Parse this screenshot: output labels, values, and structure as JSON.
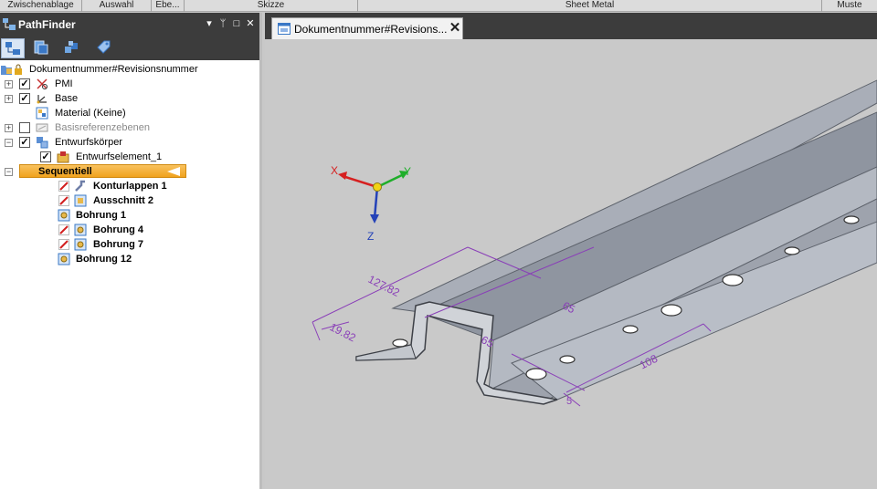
{
  "ribbon_groups": [
    "Zwischenablage",
    "Auswahl",
    "Ebe...",
    "Skizze",
    "Sheet Metal",
    "Muste"
  ],
  "panel": {
    "title": "PathFinder",
    "controls": [
      "▾",
      "ᛘ",
      "□",
      "✕"
    ],
    "tree": {
      "root": "Dokumentnummer#Revisionsnummer",
      "pmi": "PMI",
      "base": "Base",
      "material": "Material (Keine)",
      "basisref": "Basisreferenzebenen",
      "entwurfskoerper": "Entwurfskörper",
      "entwurfselement": "Entwurfselement_1",
      "sequentiell": "Sequentiell",
      "konturlappen": "Konturlappen 1",
      "ausschnitt": "Ausschnitt 2",
      "bohrung1": "Bohrung 1",
      "bohrung4": "Bohrung 4",
      "bohrung7": "Bohrung 7",
      "bohrung12": "Bohrung 12"
    }
  },
  "document_tab": {
    "label": "Dokumentnummer#Revisions...",
    "close": "✕"
  },
  "triad": {
    "x": "X",
    "y": "Y",
    "z": "Z"
  },
  "dimensions": {
    "d1": "127.82",
    "d2": "19.82",
    "d3": "65",
    "d4": "65",
    "d5": "108",
    "d6": "5"
  },
  "colors": {
    "dimension": "#8a3fb8",
    "sequence_bar": "#f0a21e",
    "part": "#a6abb5"
  }
}
